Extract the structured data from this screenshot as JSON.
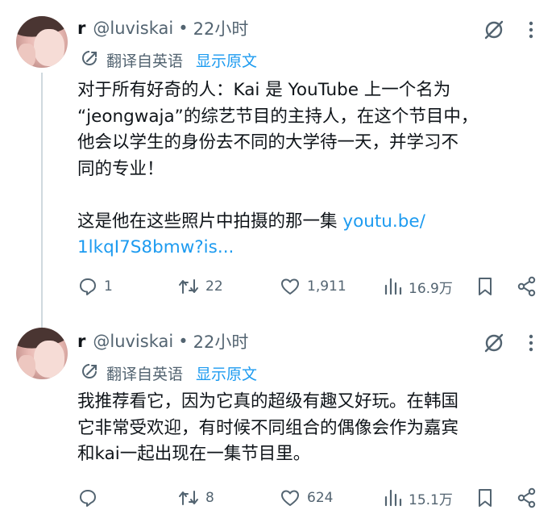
{
  "tweets": [
    {
      "display_name": "r",
      "handle": "@luviskai",
      "separator": "•",
      "time": "22小时",
      "translated_label": "翻译自英语",
      "show_original": "显示原文",
      "text_lines": [
        "对于所有好奇的人：Kai 是 YouTube 上一个名为",
        "“jeongwaja”的综艺节目的主持人，在这个节目中，",
        "他会以学生的身份去不同的大学待一天，并学习不",
        "同的专业！",
        "",
        "这是他在这些照片中拍摄的那一集 "
      ],
      "link_line_1": "youtu.be/",
      "link_line_2": "1lkqI7S8bmw?is...",
      "replies": "1",
      "retweets": "22",
      "likes": "1,911",
      "views": "16.9万"
    },
    {
      "display_name": "r",
      "handle": "@luviskai",
      "separator": "•",
      "time": "22小时",
      "translated_label": "翻译自英语",
      "show_original": "显示原文",
      "text_lines": [
        "我推荐看它，因为它真的超级有趣又好玩。在韩国",
        "它非常受欢迎，有时候不同组合的偶像会作为嘉宾",
        "和kai一起出现在一集节目里。"
      ],
      "replies": "",
      "retweets": "8",
      "likes": "624",
      "views": "15.1万"
    }
  ],
  "icons": {
    "reply": "reply-icon",
    "retweet": "retweet-icon",
    "like": "heart-icon",
    "views": "views-icon",
    "bookmark": "bookmark-icon",
    "share": "share-icon",
    "grok": "grok-icon",
    "more": "more-icon",
    "translate": "translate-icon"
  },
  "colors": {
    "text": "#0f1419",
    "muted": "#536471",
    "link": "#1d9bf0",
    "thread_line": "#cfd9de"
  }
}
